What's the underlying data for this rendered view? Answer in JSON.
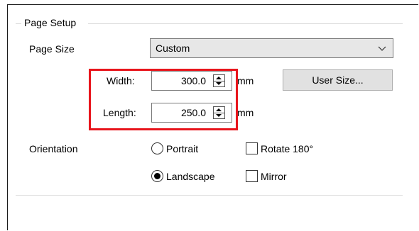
{
  "group": {
    "title": "Page Setup"
  },
  "page_size": {
    "label": "Page Size",
    "selected": "Custom"
  },
  "width": {
    "label": "Width:",
    "value": "300.0",
    "unit": "mm"
  },
  "length": {
    "label": "Length:",
    "value": "250.0",
    "unit": "mm"
  },
  "user_size_button": "User Size...",
  "orientation": {
    "label": "Orientation",
    "portrait": {
      "label": "Portrait",
      "checked": false
    },
    "landscape": {
      "label": "Landscape",
      "checked": true
    }
  },
  "options": {
    "rotate": {
      "label": "Rotate 180°",
      "checked": false
    },
    "mirror": {
      "label": "Mirror",
      "checked": false
    }
  },
  "colors": {
    "highlight": "#e8151c"
  }
}
